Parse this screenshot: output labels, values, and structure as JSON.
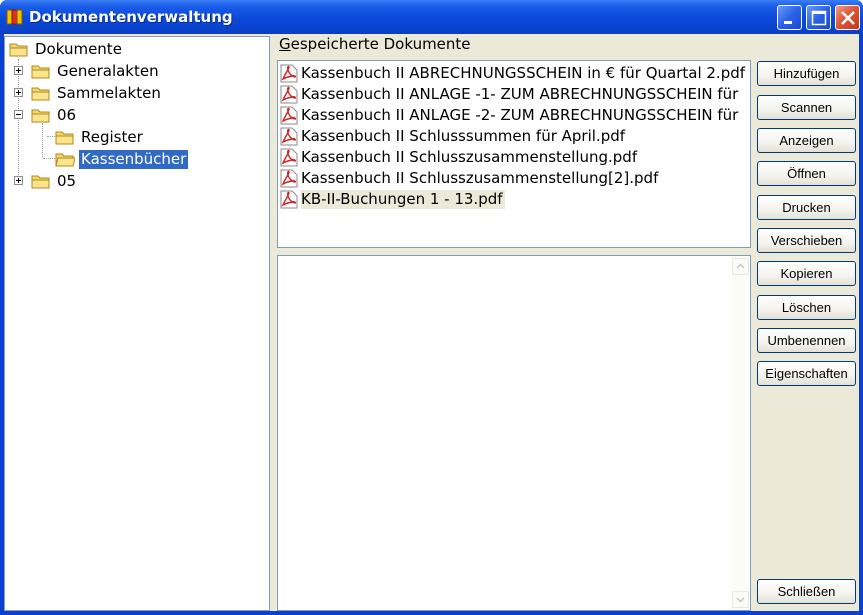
{
  "window": {
    "title": "Dokumentenverwaltung"
  },
  "tree": {
    "root": "Dokumente",
    "items": [
      {
        "label": "Generalakten"
      },
      {
        "label": "Sammelakten"
      },
      {
        "label": "06"
      },
      {
        "label": "Register"
      },
      {
        "label": "Kassenbücher"
      },
      {
        "label": "05"
      }
    ]
  },
  "documents": {
    "label_accel": "G",
    "label_rest": "espeicherte Dokumente",
    "files": [
      "Kassenbuch II ABRECHNUNGSSCHEIN in € für Quartal 2.pdf",
      "Kassenbuch II ANLAGE -1- ZUM ABRECHNUNGSSCHEIN für",
      "Kassenbuch II ANLAGE -2- ZUM ABRECHNUNGSSCHEIN für",
      "Kassenbuch II Schlusssummen für April.pdf",
      "Kassenbuch II Schlusszusammenstellung.pdf",
      "Kassenbuch II Schlusszusammenstellung[2].pdf",
      "KB-II-Buchungen 1 - 13.pdf"
    ]
  },
  "buttons": {
    "add": "Hinzufügen",
    "scan": "Scannen",
    "show": "Anzeigen",
    "open": "Öffnen",
    "print": "Drucken",
    "move": "Verschieben",
    "copy": "Kopieren",
    "delete": "Löschen",
    "rename": "Umbenennen",
    "properties": "Eigenschaften",
    "close": "Schließen"
  },
  "icons": {
    "app": "document-app-icon",
    "folder": "folder-icon",
    "pdf": "pdf-file-icon"
  }
}
